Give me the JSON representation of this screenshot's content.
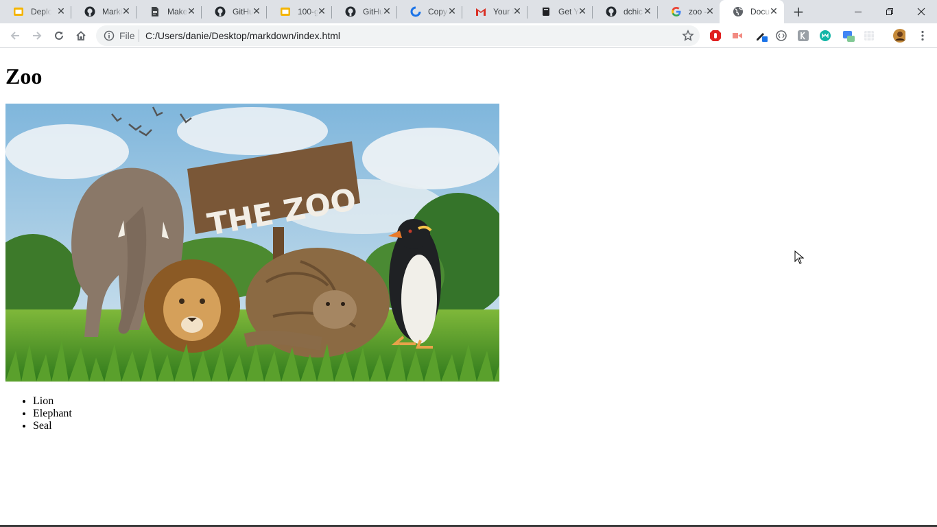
{
  "browser": {
    "tabs": [
      {
        "title": "Deplo",
        "icon": "google-slides-icon",
        "close": "✕"
      },
      {
        "title": "Marki",
        "icon": "github-icon",
        "close": "✕"
      },
      {
        "title": "Make",
        "icon": "google-docs-icon",
        "close": "✕"
      },
      {
        "title": "GitHu",
        "icon": "github-icon",
        "close": "✕"
      },
      {
        "title": "100-g",
        "icon": "google-slides-icon",
        "close": "✕"
      },
      {
        "title": "GitHu",
        "icon": "github-icon",
        "close": "✕"
      },
      {
        "title": "Copy",
        "icon": "copy-icon",
        "close": "✕"
      },
      {
        "title": "Your f",
        "icon": "gmail-icon",
        "close": "✕"
      },
      {
        "title": "Get Y",
        "icon": "book-icon",
        "close": "✕"
      },
      {
        "title": "dchic",
        "icon": "github-icon",
        "close": "✕"
      },
      {
        "title": "zoo - ",
        "icon": "google-icon",
        "close": "✕"
      },
      {
        "title": "Docu",
        "icon": "globe-icon",
        "close": "✕",
        "active": true
      }
    ],
    "new_tab": "+",
    "address": {
      "scheme_label": "File",
      "url": "C:/Users/danie/Desktop/markdown/index.html"
    }
  },
  "page": {
    "heading": "Zoo",
    "image_sign_text": "THE ZOO",
    "list": [
      "Lion",
      "Elephant",
      "Seal"
    ]
  },
  "colors": {
    "tabstrip": "#dee1e6",
    "toolbar": "#ffffff",
    "omnibox": "#f1f3f4"
  }
}
